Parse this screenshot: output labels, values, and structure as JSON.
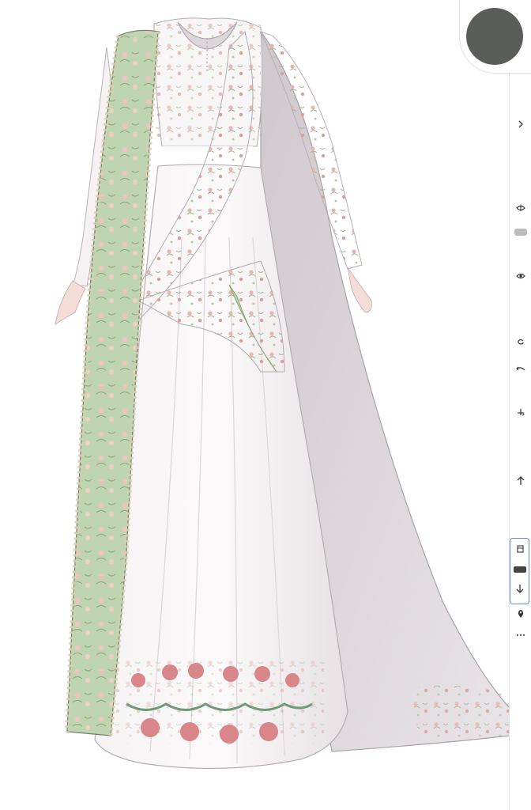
{
  "app": {
    "accent_color": "#5b8fd9",
    "current_color": "#5b5d5b"
  },
  "toolbar": {
    "collapse_icon": "chevron-right-icon",
    "pill_label": "",
    "badge_label": "",
    "tools": [
      "visibility-toggle-icon",
      "eye-icon",
      "lasso-icon",
      "undo-icon",
      "transform-icon",
      "move-up-icon",
      "layer-icon",
      "move-down-icon",
      "pin-icon",
      "more-icon"
    ]
  }
}
